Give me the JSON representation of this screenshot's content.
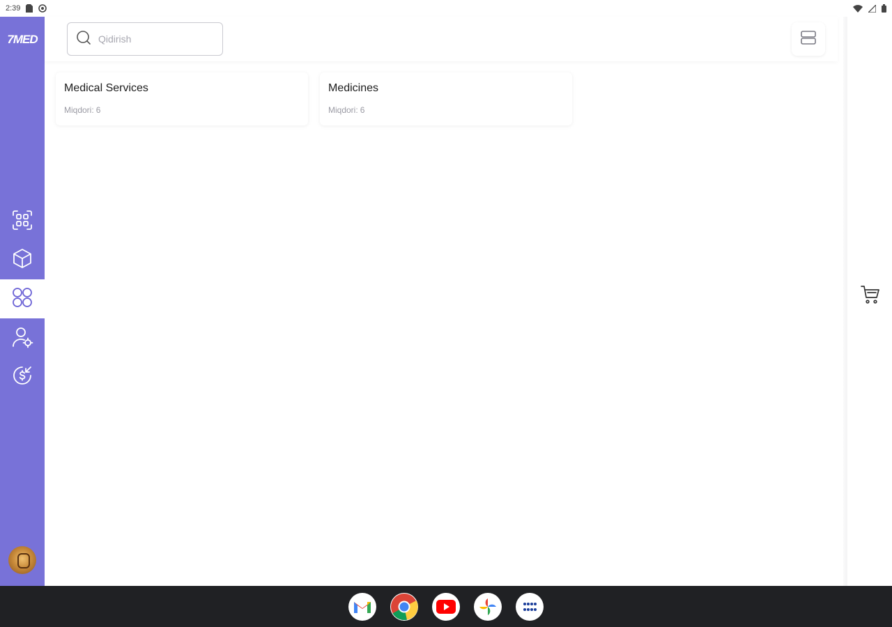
{
  "status_bar": {
    "time": "2:39"
  },
  "sidebar": {
    "logo": "7MED",
    "items": [
      {
        "name": "qr-scan",
        "active": false
      },
      {
        "name": "products",
        "active": false
      },
      {
        "name": "categories",
        "active": true
      },
      {
        "name": "users",
        "active": false
      },
      {
        "name": "payments",
        "active": false
      }
    ]
  },
  "search": {
    "placeholder": "Qidirish",
    "value": ""
  },
  "categories": [
    {
      "title": "Medical Services",
      "count_label": "Miqdori:",
      "count": "6"
    },
    {
      "title": "Medicines",
      "count_label": "Miqdori:",
      "count": "6"
    }
  ],
  "dock": {
    "apps": [
      "Gmail",
      "Chrome",
      "YouTube",
      "Photos",
      "App launcher"
    ]
  },
  "colors": {
    "sidebar": "#7872d8",
    "accent": "#6c63d6",
    "dock": "#202124"
  }
}
